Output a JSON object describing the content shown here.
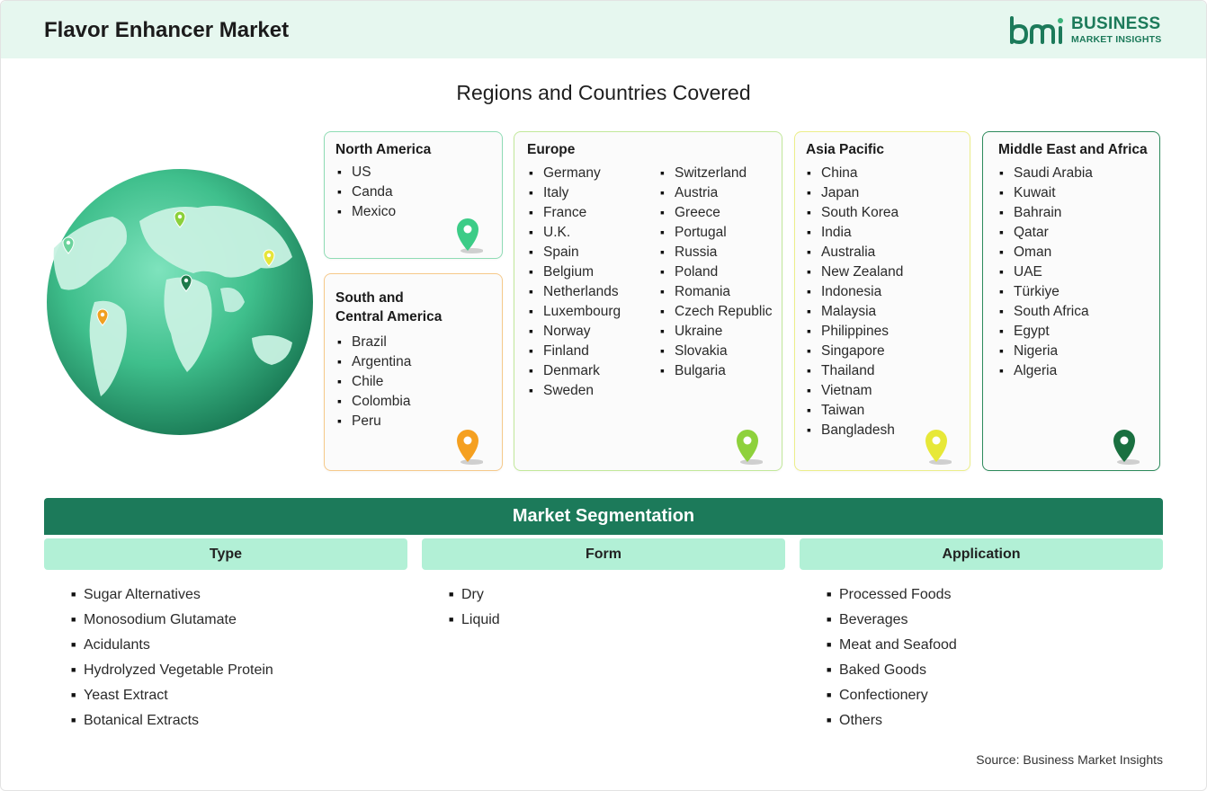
{
  "header": {
    "title": "Flavor Enhancer Market",
    "logo_line1": "BUSINESS",
    "logo_line2": "MARKET INSIGHTS",
    "brand_color": "#1c7a5a"
  },
  "regions_title": "Regions and Countries Covered",
  "regions": {
    "north_america": {
      "title": "North America",
      "countries": [
        "US",
        "Canda",
        "Mexico"
      ],
      "color": "#8fdcb5"
    },
    "south_central_america": {
      "title_line1": "South and",
      "title_line2": "Central America",
      "countries": [
        "Brazil",
        "Argentina",
        "Chile",
        "Colombia",
        "Peru"
      ],
      "color": "#f6c98a"
    },
    "europe": {
      "title": "Europe",
      "countries_col1": [
        "Germany",
        "Italy",
        "France",
        "U.K.",
        "Spain",
        "Belgium",
        "Netherlands",
        "Luxembourg",
        "Norway",
        "Finland",
        "Denmark",
        "Sweden"
      ],
      "countries_col2": [
        "Switzerland",
        "Austria",
        "Greece",
        "Portugal",
        "Russia",
        "Poland",
        "Romania",
        "Czech Republic",
        "Ukraine",
        "Slovakia",
        "Bulgaria"
      ],
      "color": "#c2e89a"
    },
    "asia_pacific": {
      "title": "Asia Pacific",
      "countries": [
        "China",
        "Japan",
        "South Korea",
        "India",
        "Australia",
        "New Zealand",
        "Indonesia",
        "Malaysia",
        "Philippines",
        "Singapore",
        "Thailand",
        "Vietnam",
        "Taiwan",
        "Bangladesh"
      ],
      "color": "#ecee8a"
    },
    "middle_east_africa": {
      "title": "Middle East and Africa",
      "countries": [
        "Saudi Arabia",
        "Kuwait",
        "Bahrain",
        "Qatar",
        "Oman",
        "UAE",
        "Türkiye",
        "South Africa",
        "Egypt",
        "Nigeria",
        "Algeria"
      ],
      "color": "#2e8a5c"
    }
  },
  "segmentation": {
    "title": "Market Segmentation",
    "type": {
      "label": "Type",
      "items": [
        "Sugar Alternatives",
        "Monosodium Glutamate",
        "Acidulants",
        "Hydrolyzed Vegetable Protein",
        "Yeast Extract",
        "Botanical Extracts"
      ]
    },
    "form": {
      "label": "Form",
      "items": [
        "Dry",
        "Liquid"
      ]
    },
    "application": {
      "label": "Application",
      "items": [
        "Processed Foods",
        "Beverages",
        "Meat and Seafood",
        "Baked Goods",
        "Confectionery",
        "Others"
      ]
    }
  },
  "source": "Source: Business Market Insights"
}
